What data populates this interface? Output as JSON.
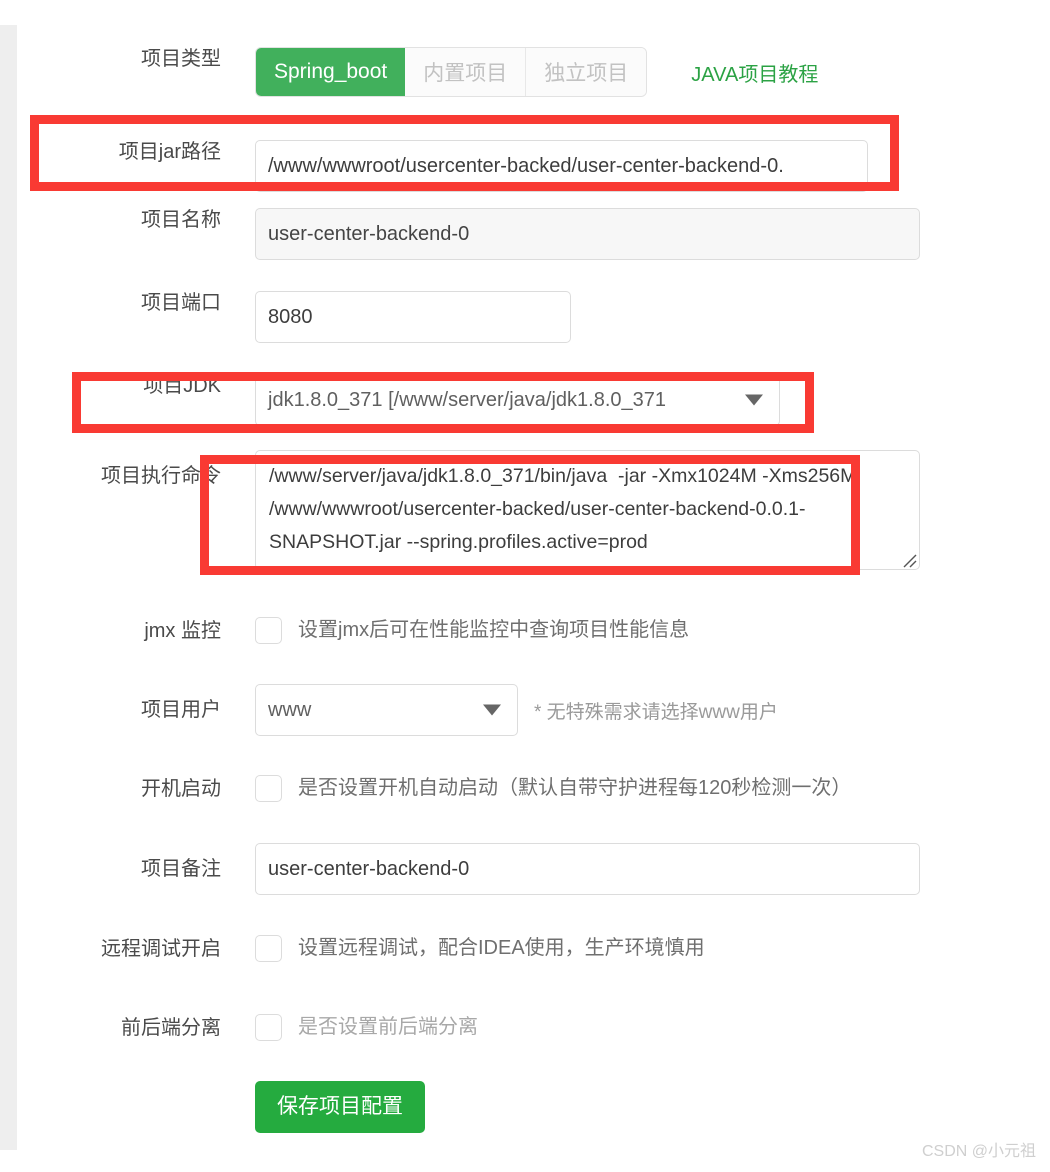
{
  "page": {
    "watermark": "CSDN @小元祖"
  },
  "project_type": {
    "label": "项目类型",
    "tabs": [
      {
        "label": "Spring_boot",
        "active": true
      },
      {
        "label": "内置项目",
        "active": false
      },
      {
        "label": "独立项目",
        "active": false
      }
    ],
    "tutorial_link": "JAVA项目教程"
  },
  "jar_path": {
    "label": "项目jar路径",
    "value": "/www/wwwroot/usercenter-backed/user-center-backend-0."
  },
  "project_name": {
    "label": "项目名称",
    "value": "user-center-backend-0"
  },
  "project_port": {
    "label": "项目端口",
    "value": "8080"
  },
  "project_jdk": {
    "label": "项目JDK",
    "value": "jdk1.8.0_371 [/www/server/java/jdk1.8.0_371",
    "caret_icon": "chevron-down-icon"
  },
  "exec_command": {
    "label": "项目执行命令",
    "value": "/www/server/java/jdk1.8.0_371/bin/java  -jar -Xmx1024M -Xms256M  /www/wwwroot/usercenter-backed/user-center-backend-0.0.1-SNAPSHOT.jar --spring.profiles.active=prod"
  },
  "jmx": {
    "label": "jmx 监控",
    "checked": false,
    "hint": "设置jmx后可在性能监控中查询项目性能信息"
  },
  "project_user": {
    "label": "项目用户",
    "value": "www",
    "note": "* 无特殊需求请选择www用户",
    "caret_icon": "chevron-down-icon"
  },
  "boot_start": {
    "label": "开机启动",
    "checked": false,
    "hint": "是否设置开机自动启动（默认自带守护进程每120秒检测一次）"
  },
  "remark": {
    "label": "项目备注",
    "value": "user-center-backend-0"
  },
  "remote_debug": {
    "label": "远程调试开启",
    "checked": false,
    "hint": "设置远程调试，配合IDEA使用，生产环境慎用"
  },
  "front_back_split": {
    "label": "前后端分离",
    "checked": false,
    "hint": "是否设置前后端分离"
  },
  "save": {
    "label": "保存项目配置"
  },
  "colors": {
    "accent_green": "#41b05c",
    "save_green": "#25ab3f",
    "link_green": "#2ba244",
    "annotation_red": "#f93a33",
    "disabled_bg": "#f7f7f7"
  }
}
